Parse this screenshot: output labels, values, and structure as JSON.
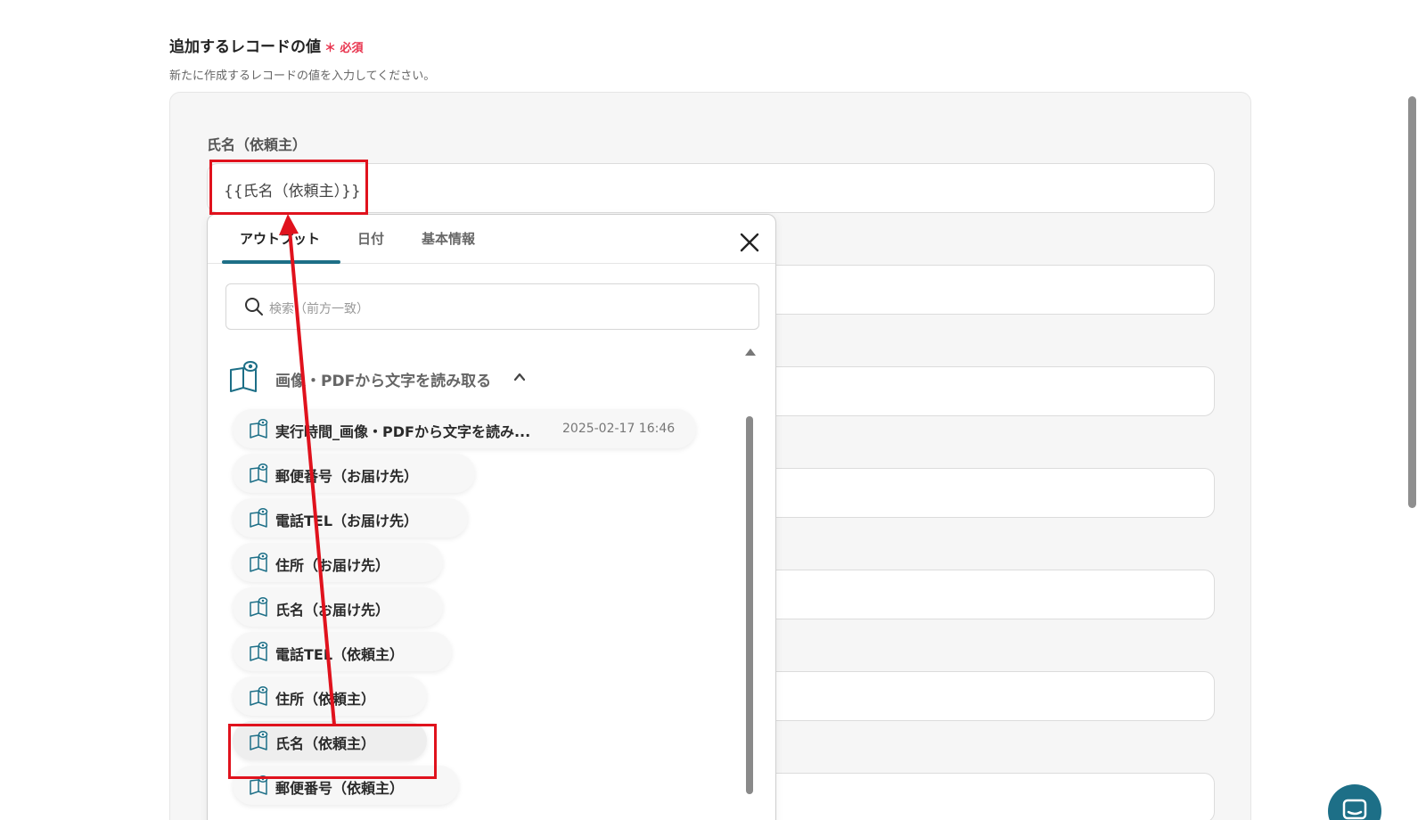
{
  "section": {
    "title": "追加するレコードの値",
    "required_mark": "＊",
    "required_label": "必須",
    "description": "新たに作成するレコードの値を入力してください。"
  },
  "form": {
    "field_label": "氏名（依頼主）",
    "field_value": "{{氏名（依頼主）}}"
  },
  "popup": {
    "tabs": [
      "アウトプット",
      "日付",
      "基本情報"
    ],
    "active_tab": "アウトプット",
    "search_placeholder": "検索（前方一致）",
    "group_title": "画像・PDFから文字を読み取る",
    "items": [
      {
        "label": "実行時間_画像・PDFから文字を読み...",
        "date": "2025-02-17 16:46"
      },
      {
        "label": "郵便番号（お届け先）"
      },
      {
        "label": "電話TEL（お届け先）"
      },
      {
        "label": "住所（お届け先）"
      },
      {
        "label": "氏名（お届け先）"
      },
      {
        "label": "電話TEL（依頼主）"
      },
      {
        "label": "住所（依頼主）"
      },
      {
        "label": "氏名（依頼主）"
      },
      {
        "label": "郵便番号（依頼主）"
      }
    ],
    "selected_item": "氏名（依頼主）"
  },
  "colors": {
    "accent": "#1d6f87",
    "annotation_red": "#e0121d",
    "required": "#e8344e"
  },
  "icons": {
    "search": "search-icon",
    "close": "close-icon",
    "group": "book-eye-icon",
    "item": "book-eye-icon",
    "chevron": "chevron-up-icon",
    "chat": "chat-icon"
  }
}
